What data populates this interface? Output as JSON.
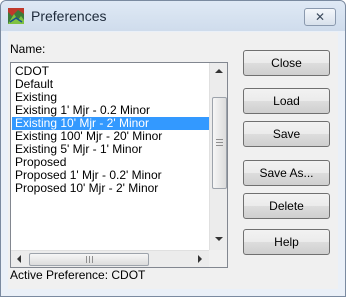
{
  "window": {
    "title": "Preferences",
    "close_glyph": "✕"
  },
  "name_label": "Name:",
  "list": {
    "items": [
      "CDOT",
      "Default",
      "Existing",
      "Existing 1' Mjr - 0.2 Minor",
      "Existing 10' Mjr - 2' Minor",
      "Existing 100' Mjr - 20' Minor",
      "Existing 5' Mjr - 1' Minor",
      "Proposed",
      "Proposed 1' Mjr - 0.2' Minor",
      "Proposed 10' Mjr - 2' Minor"
    ],
    "selected_index": 4
  },
  "buttons": {
    "close": "Close",
    "load": "Load",
    "save": "Save",
    "save_as": "Save As...",
    "delete": "Delete",
    "help": "Help"
  },
  "status": "Active Preference: CDOT",
  "colors": {
    "selection": "#3399ff",
    "window_frame": "#cfdcec"
  },
  "icons": {
    "app": "preferences-app-icon",
    "scroll_up": "scroll-up-arrow-icon",
    "scroll_down": "scroll-down-arrow-icon",
    "scroll_left": "scroll-left-arrow-icon",
    "scroll_right": "scroll-right-arrow-icon"
  }
}
